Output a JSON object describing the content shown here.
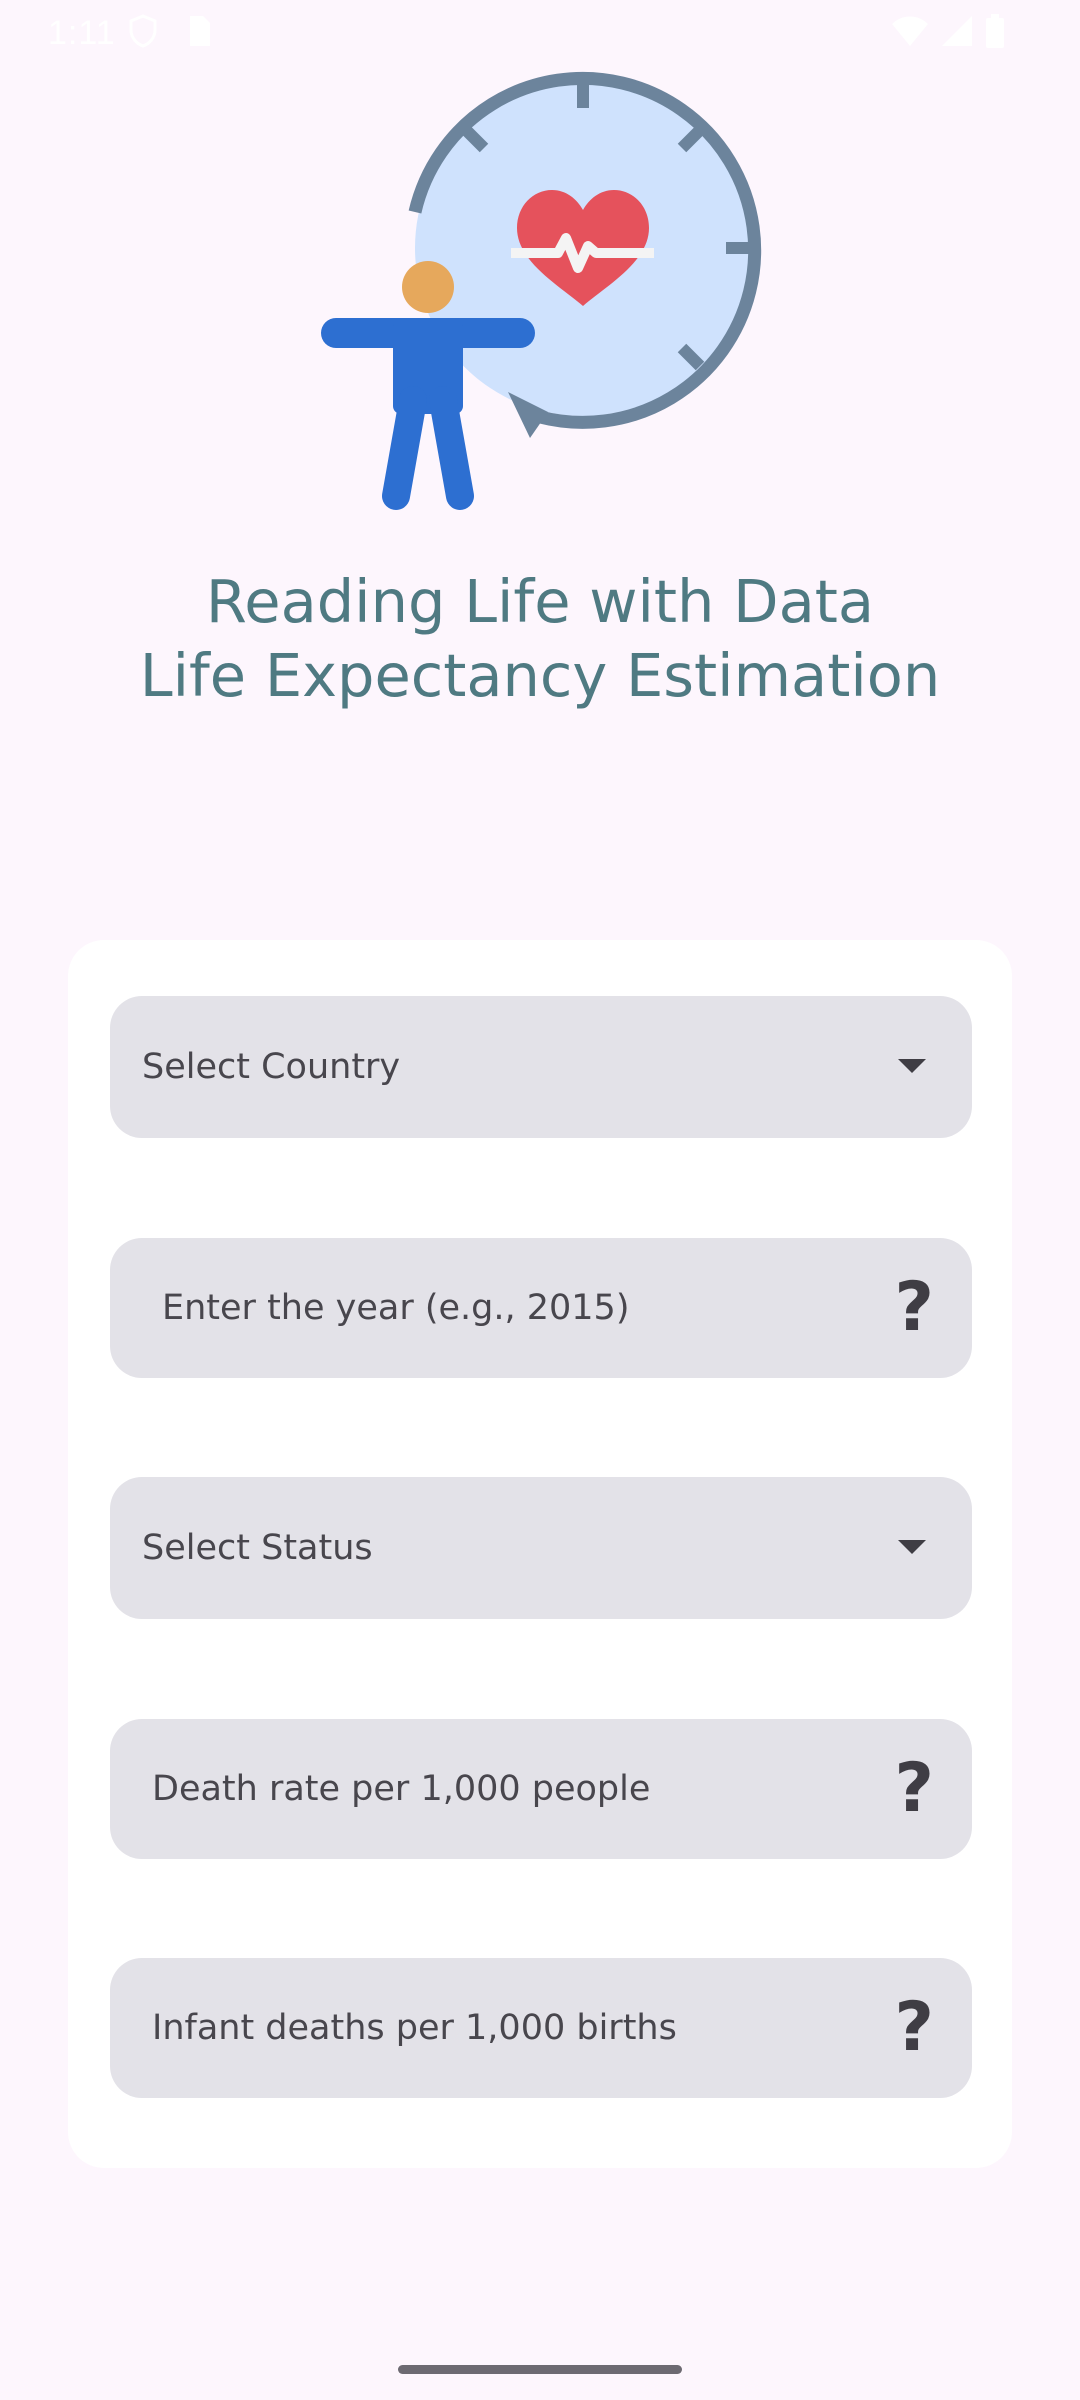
{
  "status_bar": {
    "time": "1:11",
    "left_icons": [
      "shield-icon",
      "sim-card-icon"
    ],
    "right_icons": [
      "wifi-icon",
      "signal-icon",
      "battery-icon"
    ]
  },
  "hero": {
    "icons": [
      "person-icon",
      "clock-cycle-icon",
      "heart-rate-icon"
    ]
  },
  "title": {
    "line1": "Reading Life with Data",
    "line2": "Life Expectancy Estimation"
  },
  "form": {
    "country": {
      "label": "Select Country",
      "icon": "dropdown-arrow-icon"
    },
    "year": {
      "placeholder": "Enter the year (e.g., 2015)",
      "value": "",
      "help": "?"
    },
    "status": {
      "label": "Select Status",
      "icon": "dropdown-arrow-icon"
    },
    "death_rate": {
      "placeholder": "Death rate per 1,000 people",
      "value": "",
      "help": "?"
    },
    "infant_deaths": {
      "placeholder": "Infant deaths per 1,000 births",
      "value": "",
      "help": "?"
    }
  },
  "colors": {
    "background": "#fdf6fd",
    "title": "#4f7a82",
    "field_bg": "#e3e2e8",
    "card_bg": "#ffffff",
    "person": "#2d6fd1",
    "heart": "#e5525c",
    "clock_face": "#cfe2fd",
    "clock_ring": "#6c849c"
  }
}
